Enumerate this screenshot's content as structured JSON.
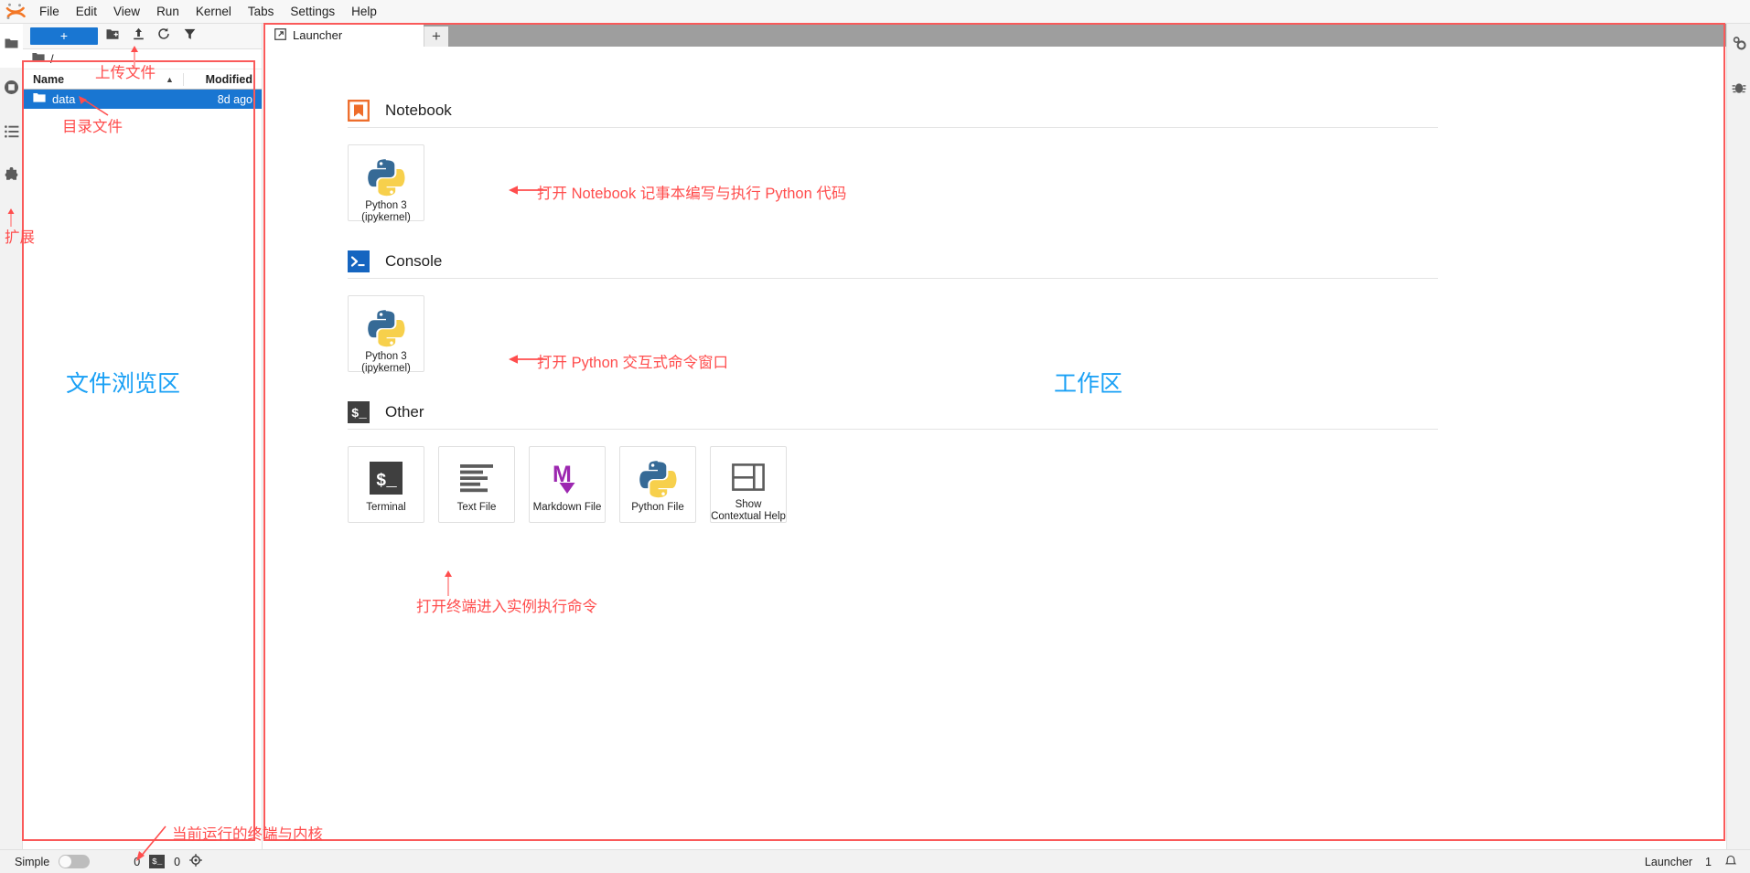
{
  "app": {
    "logo_icon": "jupyter-logo",
    "menus": [
      "File",
      "Edit",
      "View",
      "Run",
      "Kernel",
      "Tabs",
      "Settings",
      "Help"
    ]
  },
  "left_activity_bar": {
    "items": [
      {
        "name": "file-browser",
        "icon": "folder-icon",
        "active": true
      },
      {
        "name": "running-terminals-kernels",
        "icon": "stop-circle-icon",
        "active": false
      },
      {
        "name": "table-of-contents",
        "icon": "list-icon",
        "active": false
      },
      {
        "name": "extension-manager",
        "icon": "puzzle-piece-icon",
        "active": false
      }
    ]
  },
  "file_browser": {
    "toolbar": {
      "new_launcher_label": "+",
      "new_folder_icon": "new-folder-icon",
      "upload_icon": "upload-icon",
      "refresh_icon": "refresh-icon",
      "filter_icon": "filter-icon"
    },
    "breadcrumb": "/",
    "breadcrumb_icon": "folder-icon",
    "columns": [
      "Name",
      "Modified"
    ],
    "sort_icon": "caret-up-icon",
    "rows": [
      {
        "icon": "folder-icon",
        "name": "data",
        "modified": "8d ago",
        "selected": true
      }
    ]
  },
  "dock": {
    "tab": {
      "label": "Launcher",
      "icon": "launcher-icon"
    },
    "add_tab_label": "+"
  },
  "launcher": {
    "sections": [
      {
        "id": "notebook",
        "title": "Notebook",
        "icon": "notebook-bookmark-icon",
        "cards": [
          {
            "id": "python3-notebook",
            "icon": "python-icon",
            "label": "Python 3\n(ipykernel)"
          }
        ]
      },
      {
        "id": "console",
        "title": "Console",
        "icon": "console-prompt-icon",
        "cards": [
          {
            "id": "python3-console",
            "icon": "python-icon",
            "label": "Python 3\n(ipykernel)"
          }
        ]
      },
      {
        "id": "other",
        "title": "Other",
        "icon": "terminal-prompt-icon",
        "cards": [
          {
            "id": "terminal",
            "icon": "terminal-icon",
            "label": "Terminal"
          },
          {
            "id": "text-file",
            "icon": "text-lines-icon",
            "label": "Text File"
          },
          {
            "id": "markdown-file",
            "icon": "markdown-icon",
            "label": "Markdown File"
          },
          {
            "id": "python-file",
            "icon": "python-icon",
            "label": "Python File"
          },
          {
            "id": "show-contextual-help",
            "icon": "contextual-help-icon",
            "label": "Show\nContextual Help"
          }
        ]
      }
    ]
  },
  "right_activity_bar": {
    "items": [
      {
        "name": "property-inspector",
        "icon": "gears-icon"
      },
      {
        "name": "debugger",
        "icon": "bug-icon"
      }
    ]
  },
  "status_bar": {
    "simple_label": "Simple",
    "simple_toggle_on": false,
    "kernel_count": "0",
    "terminal_icon": "terminal-chip-icon",
    "terminal_count": "0",
    "kernel_icon": "kernel-gear-icon",
    "active_tab": "Launcher",
    "notification_count": "1",
    "bell_icon": "bell-icon"
  },
  "annotations": {
    "colors": {
      "red": "#ff4d4d",
      "blue": "#19a0f5",
      "box_red": "#fa5a5a"
    },
    "labels": [
      {
        "id": "upload-file",
        "text": "上传文件",
        "color": "red"
      },
      {
        "id": "directory-file",
        "text": "目录文件",
        "color": "red"
      },
      {
        "id": "extensions",
        "text": "扩展",
        "color": "red"
      },
      {
        "id": "file-browser-area",
        "text": "文件浏览区",
        "color": "blue"
      },
      {
        "id": "workspace-area",
        "text": "工作区",
        "color": "blue"
      },
      {
        "id": "open-notebook",
        "text": "打开 Notebook 记事本编写与执行 Python 代码",
        "color": "red"
      },
      {
        "id": "open-console",
        "text": "打开 Python 交互式命令窗口",
        "color": "red"
      },
      {
        "id": "open-terminal",
        "text": "打开终端进入实例执行命令",
        "color": "red"
      },
      {
        "id": "running-terminals-kernels",
        "text": "当前运行的终端与内核",
        "color": "red"
      }
    ]
  }
}
